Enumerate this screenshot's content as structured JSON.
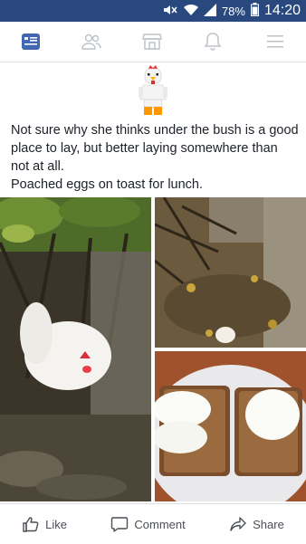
{
  "status_bar": {
    "battery": "78%",
    "time": "14:20",
    "icons": [
      "mute-icon",
      "wifi-icon",
      "signal-icon",
      "battery-icon"
    ]
  },
  "nav": {
    "items": [
      "news-feed-icon",
      "friends-icon",
      "marketplace-icon",
      "notifications-icon",
      "menu-icon"
    ],
    "active": "news-feed-icon",
    "accent": "#4267b2",
    "inactive_color": "#bec3c9"
  },
  "post": {
    "avatar_icon": "lego-chicken-avatar-icon",
    "lines": [
      "Not sure why she thinks under the bush is a good place to lay, but better laying somewhere than not at all.",
      "Poached eggs on toast for lunch."
    ],
    "photos": [
      "hen-under-bush-photo",
      "egg-on-ground-photo",
      "poached-eggs-on-toast-photo"
    ]
  },
  "actions": {
    "like": "Like",
    "comment": "Comment",
    "share": "Share"
  }
}
